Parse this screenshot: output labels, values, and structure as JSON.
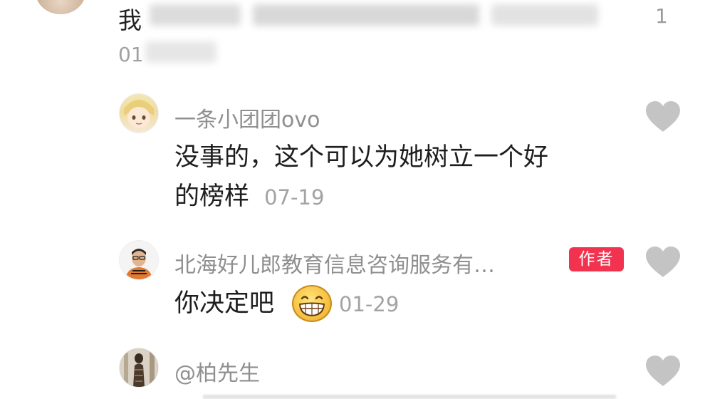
{
  "top_comment": {
    "first_char": "我",
    "like_count": "1",
    "date_prefix": "01"
  },
  "replies": [
    {
      "username": "一条小团团ovo",
      "content_line1": "没事的，这个可以为她树立一个好",
      "content_line2": "的榜样",
      "date": "07-19",
      "is_author": false
    },
    {
      "username": "北海好儿郎教育信息咨询服务有…",
      "author_badge": "作者",
      "content": "你决定吧",
      "date": "01-29",
      "is_author": true
    },
    {
      "username": "@柏先生",
      "is_author": false
    }
  ],
  "colors": {
    "author_badge_bg": "#f2334f",
    "heart": "#c4c4c4",
    "username": "#8f8f8f",
    "date": "#a3a3a3"
  },
  "icons": [
    "heart-icon",
    "grin-emoji-icon"
  ]
}
